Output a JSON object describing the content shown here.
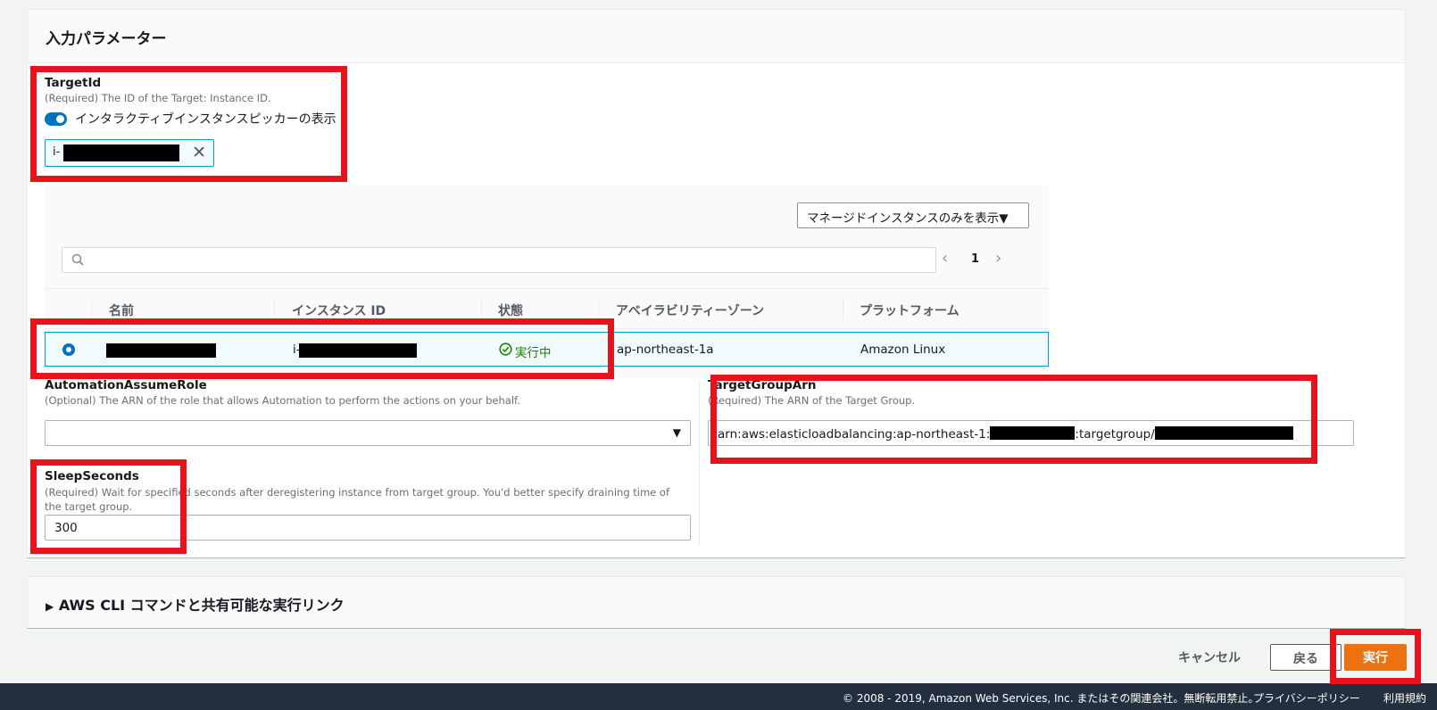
{
  "panel": {
    "title": "入力パラメーター"
  },
  "target_id": {
    "label": "TargetId",
    "description": "(Required) The ID of the Target: Instance ID.",
    "toggle_label": "インタラクティブインスタンスピッカーの表示",
    "token_prefix": "i-"
  },
  "picker": {
    "filter_button": "マネージドインスタンスのみを表示",
    "pager": {
      "page": "1"
    },
    "columns": [
      "名前",
      "インスタンス ID",
      "状態",
      "アベイラビリティーゾーン",
      "プラットフォーム"
    ],
    "rows": [
      {
        "name": "",
        "instance_id_prefix": "i-",
        "state": "実行中",
        "az": "ap-northeast-1a",
        "platform": "Amazon Linux"
      }
    ]
  },
  "automation_role": {
    "label": "AutomationAssumeRole",
    "description": "(Optional) The ARN of the role that allows Automation to perform the actions on your behalf.",
    "value": ""
  },
  "target_group": {
    "label": "TargetGroupArn",
    "description": "(Required) The ARN of the Target Group.",
    "value_prefix": "arn:aws:elasticloadbalancing:ap-northeast-1:",
    "value_mid": ":targetgroup/"
  },
  "sleep": {
    "label": "SleepSeconds",
    "description": "(Required) Wait for specified seconds after deregistering instance from target group. You'd better specify draining time of the target group.",
    "value": "300"
  },
  "cli_section": {
    "title": "AWS CLI コマンドと共有可能な実行リンク"
  },
  "actions": {
    "cancel": "キャンセル",
    "back": "戻る",
    "run": "実行"
  },
  "footer": {
    "copyright": "© 2008 - 2019, Amazon Web Services, Inc. またはその関連会社。無断転用禁止。",
    "privacy": "プライバシーポリシー",
    "terms": "利用規約"
  },
  "colors": {
    "accent": "#0073bb",
    "primary_button": "#ec7211",
    "highlight": "#e8121d",
    "status_ok": "#1d8102"
  }
}
